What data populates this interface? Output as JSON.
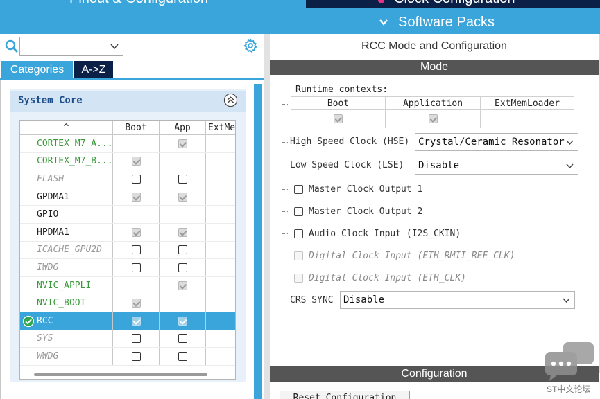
{
  "top_tabs": {
    "pinout_label": "Pinout & Configuration",
    "clock_label": "Clock Configuration",
    "software_packs_label": "Software Packs"
  },
  "left_panel": {
    "tabs": {
      "categories": "Categories",
      "az": "A->Z"
    },
    "category_title": "System Core",
    "table": {
      "headers": {
        "sort_glyph": "^",
        "boot": "Boot",
        "app": "App",
        "extmem": "ExtMe"
      },
      "rows": [
        {
          "name": "CORTEX_M7_A...",
          "style": "green",
          "boot": "none",
          "app": "disabled-checked"
        },
        {
          "name": "CORTEX_M7_B...",
          "style": "green",
          "boot": "disabled-checked",
          "app": "none"
        },
        {
          "name": "FLASH",
          "style": "grey",
          "boot": "unchecked",
          "app": "unchecked"
        },
        {
          "name": "GPDMA1",
          "style": "black",
          "boot": "disabled-checked",
          "app": "disabled-checked"
        },
        {
          "name": "GPIO",
          "style": "black",
          "boot": "none",
          "app": "none"
        },
        {
          "name": "HPDMA1",
          "style": "black",
          "boot": "disabled-checked",
          "app": "disabled-checked"
        },
        {
          "name": "ICACHE_GPU2D",
          "style": "grey",
          "boot": "unchecked",
          "app": "unchecked"
        },
        {
          "name": "IWDG",
          "style": "grey",
          "boot": "unchecked",
          "app": "unchecked"
        },
        {
          "name": "NVIC_APPLI",
          "style": "green",
          "boot": "none",
          "app": "disabled-checked"
        },
        {
          "name": "NVIC_BOOT",
          "style": "green",
          "boot": "disabled-checked",
          "app": "none"
        },
        {
          "name": "RCC",
          "style": "selected",
          "boot": "disabled-checked",
          "app": "disabled-checked"
        },
        {
          "name": "SYS",
          "style": "grey",
          "boot": "unchecked",
          "app": "unchecked"
        },
        {
          "name": "WWDG",
          "style": "grey",
          "boot": "unchecked",
          "app": "unchecked"
        }
      ]
    }
  },
  "right_panel": {
    "title": "RCC Mode and Configuration",
    "mode_header": "Mode",
    "runtime_contexts_label": "Runtime contexts:",
    "runtime_columns": [
      "Boot",
      "Application",
      "ExtMemLoader"
    ],
    "runtime_values": [
      "disabled-checked",
      "disabled-checked",
      "none"
    ],
    "hse": {
      "label": "High Speed Clock (HSE)",
      "value": "Crystal/Ceramic Resonator"
    },
    "lse": {
      "label": "Low Speed Clock (LSE)",
      "value": "Disable"
    },
    "options": [
      {
        "label": "Master Clock Output 1",
        "enabled": true
      },
      {
        "label": "Master Clock Output 2",
        "enabled": true
      },
      {
        "label": "Audio Clock Input (I2S_CKIN)",
        "enabled": true
      },
      {
        "label": "Digital Clock Input (ETH_RMII_REF_CLK)",
        "enabled": false
      },
      {
        "label": "Digital Clock Input (ETH_CLK)",
        "enabled": false
      }
    ],
    "crs": {
      "label": "CRS SYNC",
      "value": "Disable"
    },
    "configuration_header": "Configuration",
    "reset_button": "Reset Configuration"
  },
  "watermark": {
    "text": "ST中文论坛"
  },
  "colors": {
    "accent": "#3aa5db",
    "dark_tab": "#0b2046",
    "section_bar": "#555555",
    "green_text": "#3a9a3a"
  }
}
